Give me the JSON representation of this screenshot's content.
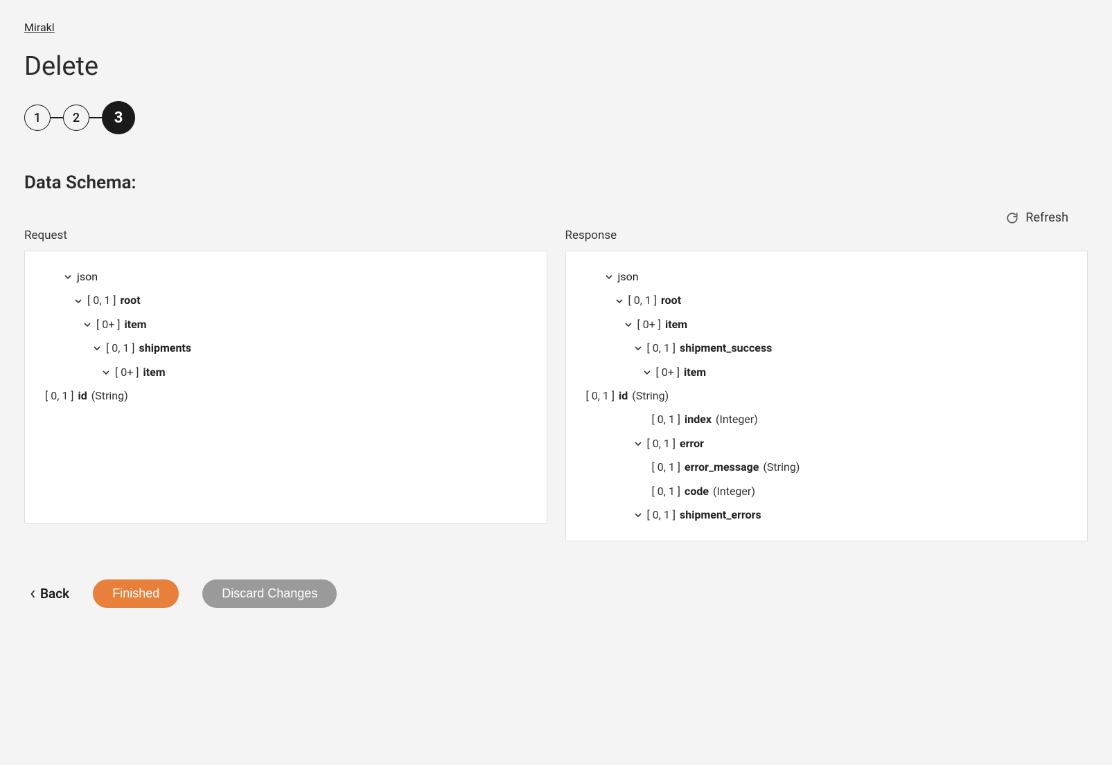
{
  "breadcrumb": "Mirakl",
  "page_title": "Delete",
  "stepper": {
    "s1": "1",
    "s2": "2",
    "s3": "3"
  },
  "section_title": "Data Schema:",
  "refresh_label": "Refresh",
  "request": {
    "header": "Request",
    "root_label": "json",
    "r0_card": "[ 0, 1 ]",
    "r0_name": "root",
    "r1_card": "[ 0+ ]",
    "r1_name": "item",
    "r2_card": "[ 0, 1 ]",
    "r2_name": "shipments",
    "r3_card": "[ 0+ ]",
    "r3_name": "item",
    "r4_card": "[ 0, 1 ]",
    "r4_name": "id",
    "r4_type": "(String)"
  },
  "response": {
    "header": "Response",
    "root_label": "json",
    "r0_card": "[ 0, 1 ]",
    "r0_name": "root",
    "r1_card": "[ 0+ ]",
    "r1_name": "item",
    "r2_card": "[ 0, 1 ]",
    "r2_name": "shipment_success",
    "r3_card": "[ 0+ ]",
    "r3_name": "item",
    "r4_card": "[ 0, 1 ]",
    "r4_name": "id",
    "r4_type": "(String)",
    "r5_card": "[ 0, 1 ]",
    "r5_name": "index",
    "r5_type": "(Integer)",
    "r6_card": "[ 0, 1 ]",
    "r6_name": "error",
    "r7_card": "[ 0, 1 ]",
    "r7_name": "error_message",
    "r7_type": "(String)",
    "r8_card": "[ 0, 1 ]",
    "r8_name": "code",
    "r8_type": "(Integer)",
    "r9_card": "[ 0, 1 ]",
    "r9_name": "shipment_errors"
  },
  "footer": {
    "back": "Back",
    "finished": "Finished",
    "discard": "Discard Changes"
  }
}
